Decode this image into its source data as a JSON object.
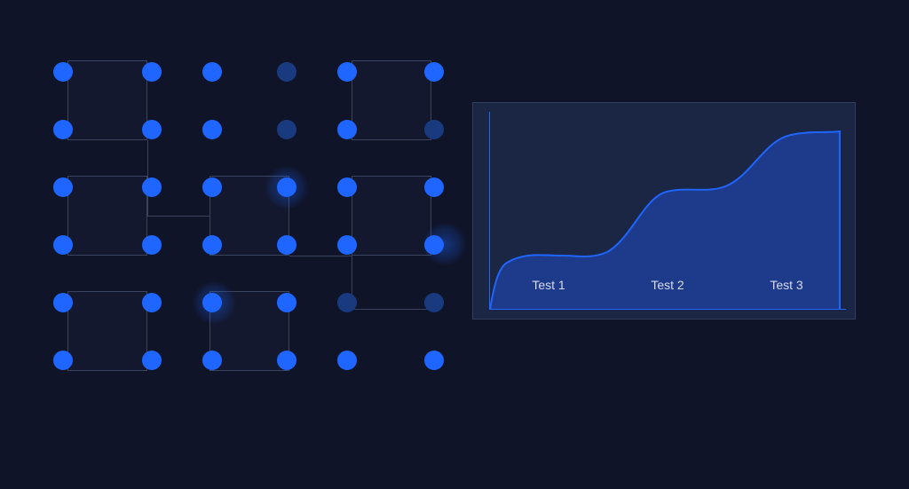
{
  "colors": {
    "background": "#0f1428",
    "dot_bright": "#1e66ff",
    "dot_dim": "#1a3a80",
    "box_border": "rgba(120, 135, 165, 0.4)",
    "chart_fill": "#1e3a8a",
    "chart_stroke": "#1e66ff",
    "chart_bg": "#1b2544"
  },
  "chart_data": {
    "type": "area",
    "categories": [
      "Test 1",
      "Test 2",
      "Test 3"
    ],
    "values": [
      0.28,
      0.6,
      0.9
    ],
    "title": "",
    "xlabel": "",
    "ylabel": "",
    "ylim": [
      0,
      1
    ]
  },
  "diagram": {
    "grid_cols": 6,
    "grid_rows": 6,
    "boxes": [
      {
        "col": 0,
        "row": 0
      },
      {
        "col": 0,
        "row": 2
      },
      {
        "col": 0,
        "row": 4
      },
      {
        "col": 2,
        "row": 2
      },
      {
        "col": 2,
        "row": 4
      },
      {
        "col": 4,
        "row": 0
      },
      {
        "col": 4,
        "row": 2
      }
    ]
  }
}
